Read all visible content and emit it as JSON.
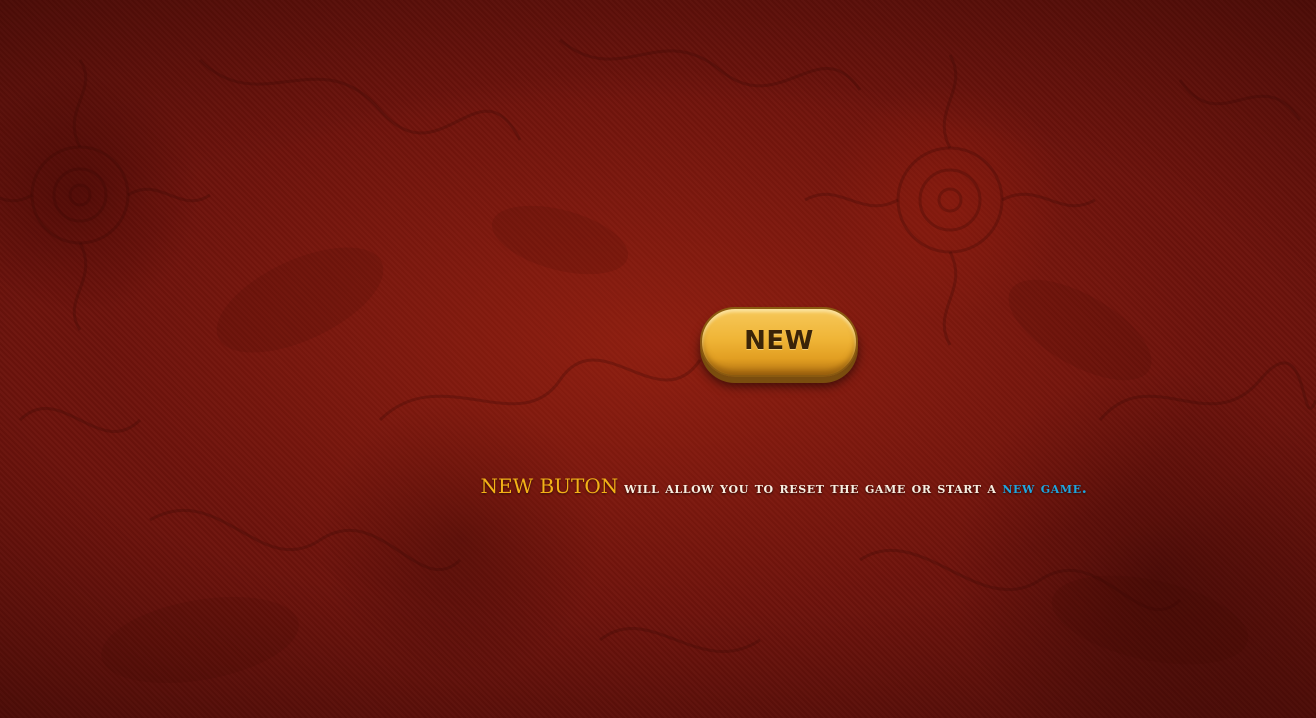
{
  "new_button": {
    "label": "NEW"
  },
  "help": {
    "highlight_button": "NEW BUTON",
    "body": " will allow you to reset the game or start a ",
    "highlight_game": "new game."
  },
  "colors": {
    "background": "#6e130c",
    "button_gold": "#f0b537",
    "highlight_gold": "#f3b217",
    "highlight_blue": "#1fa6e0",
    "body_text": "#f8efe2"
  }
}
